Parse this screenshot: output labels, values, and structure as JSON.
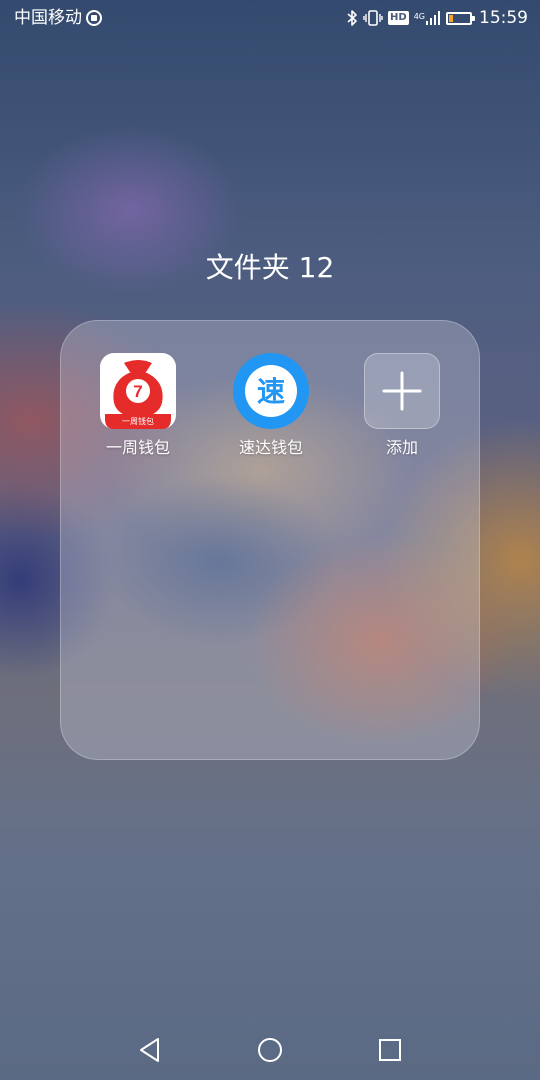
{
  "status_bar": {
    "carrier": "中国移动",
    "network_label": "4G",
    "hd_badge": "HD",
    "time": "15:59",
    "battery_level": 0.2,
    "icons": [
      "carrier-service-icon",
      "bluetooth-icon",
      "vibrate-icon",
      "hd-icon",
      "signal-icon",
      "battery-icon"
    ]
  },
  "folder": {
    "title": "文件夹 12",
    "apps": [
      {
        "label": "一周钱包",
        "icon": "money-bag-seven-icon",
        "icon_caption": "一周钱包",
        "icon_glyph": "7",
        "color": "#e62b2b"
      },
      {
        "label": "速达钱包",
        "icon": "speed-wallet-icon",
        "icon_glyph": "速",
        "color": "#2196f3"
      },
      {
        "label": "添加",
        "icon": "plus-icon"
      }
    ]
  },
  "nav_bar": {
    "icons": [
      "back-icon",
      "home-icon",
      "recent-apps-icon"
    ]
  }
}
